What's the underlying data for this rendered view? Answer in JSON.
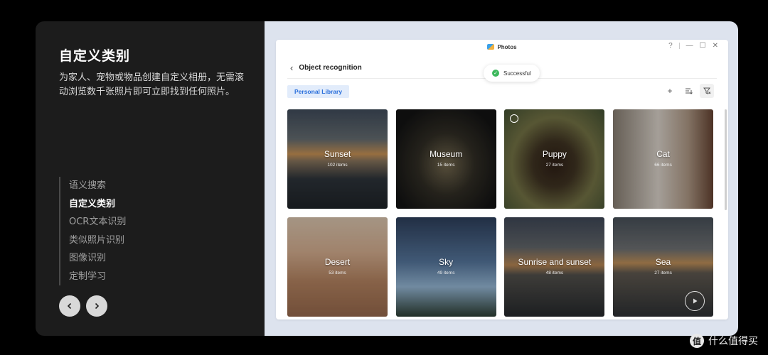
{
  "left_panel": {
    "title": "自定义类别",
    "description": "为家人、宠物或物品创建自定义相册，无需滚动浏览数千张照片即可立即找到任何照片。",
    "features": [
      {
        "label": "语义搜索",
        "active": false
      },
      {
        "label": "自定义类别",
        "active": true
      },
      {
        "label": "OCR文本识别",
        "active": false
      },
      {
        "label": "类似照片识别",
        "active": false
      },
      {
        "label": "图像识别",
        "active": false
      },
      {
        "label": "定制学习",
        "active": false
      }
    ],
    "nav": {
      "prev_icon": "chevron-left-icon",
      "next_icon": "chevron-right-icon"
    }
  },
  "app": {
    "title": "Photos",
    "window_controls": {
      "help": "?",
      "minimize": "—",
      "maximize": "☐",
      "close": "✕"
    },
    "page_title": "Object recognition",
    "toast": "Successful",
    "library_label": "Personal Library",
    "tools": [
      "add-icon",
      "sort-icon",
      "filter-icon"
    ],
    "albums": [
      {
        "name": "Sunset",
        "count": "102 items",
        "style": "t-sunset"
      },
      {
        "name": "Museum",
        "count": "15 items",
        "style": "t-museum"
      },
      {
        "name": "Puppy",
        "count": "27 items",
        "style": "t-puppy"
      },
      {
        "name": "Cat",
        "count": "66 items",
        "style": "t-cat"
      },
      {
        "name": "Desert",
        "count": "53 items",
        "style": "t-desert"
      },
      {
        "name": "Sky",
        "count": "49 items",
        "style": "t-sky"
      },
      {
        "name": "Sunrise and sunset",
        "count": "48 items",
        "style": "t-sunrise"
      },
      {
        "name": "Sea",
        "count": "27 items",
        "style": "t-sea"
      }
    ]
  },
  "watermark": {
    "logo": "值",
    "text": "什么值得买"
  },
  "colors": {
    "accent": "#2a6fdb",
    "success": "#3cb85c",
    "panel_dark": "#1c1c1c",
    "panel_light": "#dde3ee"
  }
}
